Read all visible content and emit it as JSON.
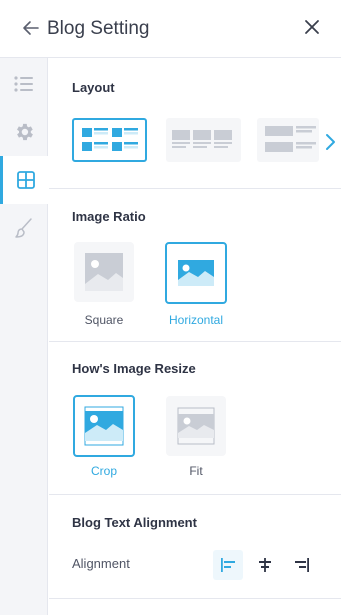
{
  "header": {
    "title": "Blog Setting",
    "back_icon": "arrow-left-icon",
    "close_icon": "close-icon"
  },
  "rail": {
    "items": [
      {
        "icon": "list-icon",
        "active": false
      },
      {
        "icon": "gear-icon",
        "active": false
      },
      {
        "icon": "layout-grid-icon",
        "active": true
      },
      {
        "icon": "brush-icon",
        "active": false
      }
    ]
  },
  "layout_section": {
    "title": "Layout",
    "options": [
      {
        "name": "grid-2-column",
        "selected": true
      },
      {
        "name": "grid-3-column",
        "selected": false
      },
      {
        "name": "list-left-image",
        "selected": false
      }
    ],
    "next_icon": "chevron-right-icon"
  },
  "image_ratio": {
    "title": "Image Ratio",
    "options": [
      {
        "label": "Square",
        "selected": false
      },
      {
        "label": "Horizontal",
        "selected": true
      }
    ]
  },
  "image_resize": {
    "title": "How's Image Resize",
    "options": [
      {
        "label": "Crop",
        "selected": true
      },
      {
        "label": "Fit",
        "selected": false
      }
    ]
  },
  "text_alignment": {
    "title": "Blog Text Alignment",
    "label": "Alignment",
    "options": [
      {
        "icon": "align-left-icon",
        "selected": true
      },
      {
        "icon": "align-center-icon",
        "selected": false
      },
      {
        "icon": "align-right-icon",
        "selected": false
      }
    ]
  },
  "colors": {
    "accent": "#30a9e0",
    "accent_light": "#cdebf8",
    "placeholder_gray": "#c9cdd5"
  }
}
